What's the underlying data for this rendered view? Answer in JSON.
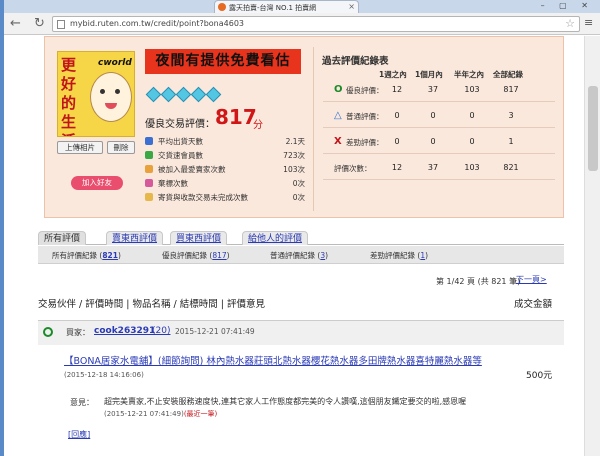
{
  "browser": {
    "tab_title": "露天拍賣-台灣 NO.1 拍賣網",
    "url": "mybid.ruten.com.tw/credit/point?bona4603"
  },
  "profile": {
    "logo": {
      "vertical_text": "更好的生活",
      "brand": "cworld"
    },
    "banner": "夜間有提供免費看估",
    "diamond_count": 5,
    "upload_label": "上傳相片",
    "delete_label": "刪除",
    "friend_label": "加入好友",
    "score_label": "優良交易評價：",
    "score_value": "817",
    "score_unit": "分",
    "stats": [
      {
        "label": "平均出貨天數",
        "value": "2.1天",
        "color": "#3b6fd1"
      },
      {
        "label": "交貨速會員數",
        "value": "723次",
        "color": "#39a845"
      },
      {
        "label": "被加入最愛賣家次數",
        "value": "103次",
        "color": "#e9a13b"
      },
      {
        "label": "棄標次數",
        "value": "0次",
        "color": "#d65a9b"
      },
      {
        "label": "寄貨與收款交易未完成次數",
        "value": "0次",
        "color": "#e6b84a"
      }
    ]
  },
  "history": {
    "title": "過去評價紀錄表",
    "columns": [
      "1週之內",
      "1個月內",
      "半年之內",
      "全部紀錄"
    ],
    "rows": [
      {
        "label": "優良評價：",
        "icon": "O",
        "color": "#1a8a2a",
        "values": [
          "12",
          "37",
          "103",
          "817"
        ]
      },
      {
        "label": "普通評價：",
        "icon": "△",
        "color": "#2a6fd1",
        "values": [
          "0",
          "0",
          "0",
          "3"
        ]
      },
      {
        "label": "差勁評價：",
        "icon": "X",
        "color": "#c0141a",
        "values": [
          "0",
          "0",
          "0",
          "1"
        ]
      },
      {
        "label": "評價次數：",
        "icon": "",
        "color": "#333333",
        "values": [
          "12",
          "37",
          "103",
          "821"
        ]
      }
    ]
  },
  "tabs": [
    {
      "label": "所有評價"
    },
    {
      "label": "賣東西評價"
    },
    {
      "label": "買東西評價"
    },
    {
      "label": "給他人的評價"
    }
  ],
  "subtabs": [
    {
      "label": "所有評價紀錄 (",
      "count": "821",
      "end": ")"
    },
    {
      "label": "優良評價紀錄 (",
      "count": "817",
      "end": ")"
    },
    {
      "label": "普通評價紀錄 (",
      "count": "3",
      "end": ")"
    },
    {
      "label": "差勁評價紀錄 (",
      "count": "1",
      "end": ")"
    }
  ],
  "pager": {
    "text": "第 1/42 頁 (共 821 筆)",
    "next": "下一頁>"
  },
  "list_header": {
    "left": "交易伙伴 / 評價時間 | 物品名稱 / 結標時間 | 評價意見",
    "right": "成交金額"
  },
  "record": {
    "role": "買家：",
    "user": "cook263291",
    "count": "(20)",
    "time": "2015-12-21 07:41:49",
    "product": "【BONA居家水電舖】(細節詢問) 林內熱水器莊頭北熱水器櫻花熱水器多田牌熱水器喜特麗熱水器等",
    "product_date": "(2015-12-18 14:16:06)",
    "price": "500元",
    "comment_label": "意見：",
    "comment": "超完美賣家,不止安裝服務速度快,連其它家人工作態度都完美的令人讚嘆,這個朋友鐵定要交的啦,感恩喔",
    "comment_date": "(2015-12-21 07:41:49)",
    "comment_latest": "(最近一筆)",
    "reply": "[回應]"
  }
}
